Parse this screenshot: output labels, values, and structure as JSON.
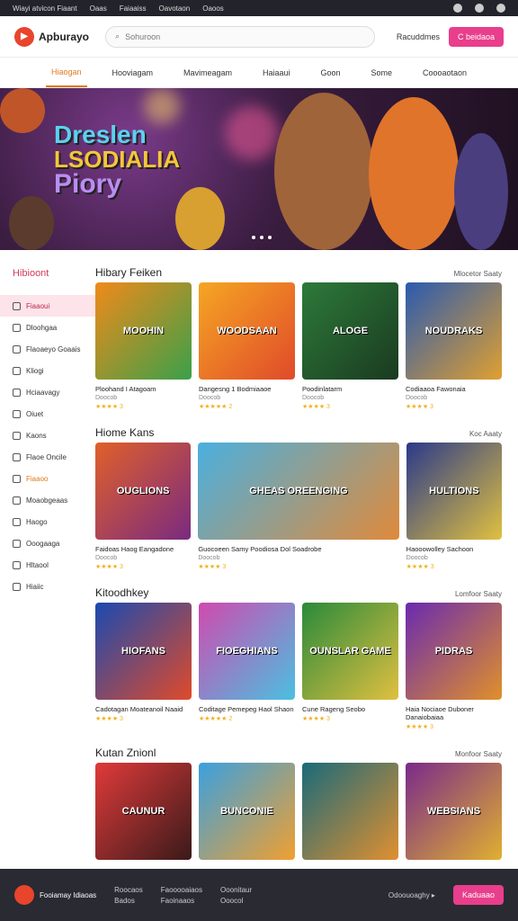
{
  "topbar": {
    "links": [
      "Wiayi atvicon Fiaant",
      "Oaas",
      "Faiaaiss",
      "Oavotaon",
      "Oaoos"
    ]
  },
  "header": {
    "logo": "Apburayo",
    "search_placeholder": "Sohuroon",
    "ghost_button": "Racuddmes",
    "cta_button": "C beidaoa"
  },
  "nav": {
    "tabs": [
      "Hiaogan",
      "Hooviagam",
      "Mavimeagam",
      "Haiaaui",
      "Goon",
      "Some",
      "Coooaotaon"
    ]
  },
  "hero": {
    "line1": "Dreslen",
    "line2": "LSODIALIA",
    "line3": "Piory"
  },
  "sidebar": {
    "title": "Hibioont",
    "items": [
      "Fiaaoui",
      "Dloohgaa",
      "Flaoaeyo Goaais",
      "Kliogi",
      "Hciaavagy",
      "Oiuet",
      "Kaons",
      "Flaoe Oncile",
      "Fiaaoo",
      "Moaobgeaas",
      "Haogo",
      "Ooogaaga",
      "Hltaool",
      "Hiaiic"
    ]
  },
  "sections": [
    {
      "title": "Hibary Feiken",
      "more": "Mlocetor Saaty",
      "cards": [
        {
          "art": "MOOHIN",
          "name": "Ploohand I Atagoam",
          "sub": "Doocob",
          "rating": "★★★★ 3"
        },
        {
          "art": "WOODSAAN",
          "name": "Dangesng 1 Bodmiaaoe",
          "sub": "Doocob",
          "rating": "★★★★★ 2"
        },
        {
          "art": "ALOGE",
          "name": "Poodinlatarm",
          "sub": "Doocob",
          "rating": "★★★★ 3"
        },
        {
          "art": "NOUDRAKS",
          "name": "Codiaaoa Fawonaia",
          "sub": "Doocob",
          "rating": "★★★★ 3"
        }
      ]
    },
    {
      "title": "Hiome Kans",
      "more": "Koc Aaaty",
      "cards": [
        {
          "art": "OUGLIONS",
          "name": "Faidoas Haog Eangadone",
          "sub": "Doocob",
          "rating": "★★★★ 3"
        },
        {
          "art": "GHEAS OREENGING",
          "name": "Guocoeen Samy Poodiosa Dol Soadrobe",
          "sub": "Doocob",
          "rating": "★★★★ 3"
        },
        {
          "art": "HULTIONS",
          "name": "Haooowolley Sachoon",
          "sub": "Doocob",
          "rating": "★★★★ 3"
        }
      ]
    },
    {
      "title": "Kitoodhkey",
      "more": "Lomfoor Saaty",
      "cards": [
        {
          "art": "HIOFANS",
          "name": "Cadotagan Moateanoil Naaid",
          "sub": "",
          "rating": "★★★★ 3"
        },
        {
          "art": "FIOEGHIANS",
          "name": "Coditage Pemepeg Haol Shaon",
          "sub": "",
          "rating": "★★★★★ 2"
        },
        {
          "art": "OUNSLAR GAME",
          "name": "Cune Rageng Seobo",
          "sub": "",
          "rating": "★★★★ 3"
        },
        {
          "art": "PIDRAS",
          "name": "Haia Nociaoe Duboner Danaiobaiaa",
          "sub": "",
          "rating": "★★★★ 3"
        }
      ]
    },
    {
      "title": "Kutan Znionl",
      "more": "Monfoor Saaty",
      "cards": [
        {
          "art": "CAUNUR",
          "name": "",
          "sub": "",
          "rating": ""
        },
        {
          "art": "BUNCONIE",
          "name": "",
          "sub": "",
          "rating": ""
        },
        {
          "art": "",
          "name": "",
          "sub": "",
          "rating": ""
        },
        {
          "art": "WEBSIANS",
          "name": "",
          "sub": "",
          "rating": ""
        }
      ]
    }
  ],
  "footer": {
    "brand": "Fooiamay Idiaoas",
    "col1": [
      "Roocaos",
      "Bados"
    ],
    "col2": [
      "Faooooaiaos",
      "Faoinaaos"
    ],
    "col3": [
      "Ooonitaur",
      "Ooocol"
    ],
    "right_text": "Odoouoaghy ▸",
    "cta": "Kaduaao"
  },
  "colors": {
    "accent": "#e83e8c",
    "nav_active": "#e07a20",
    "footer_bg": "#2a2a33"
  }
}
